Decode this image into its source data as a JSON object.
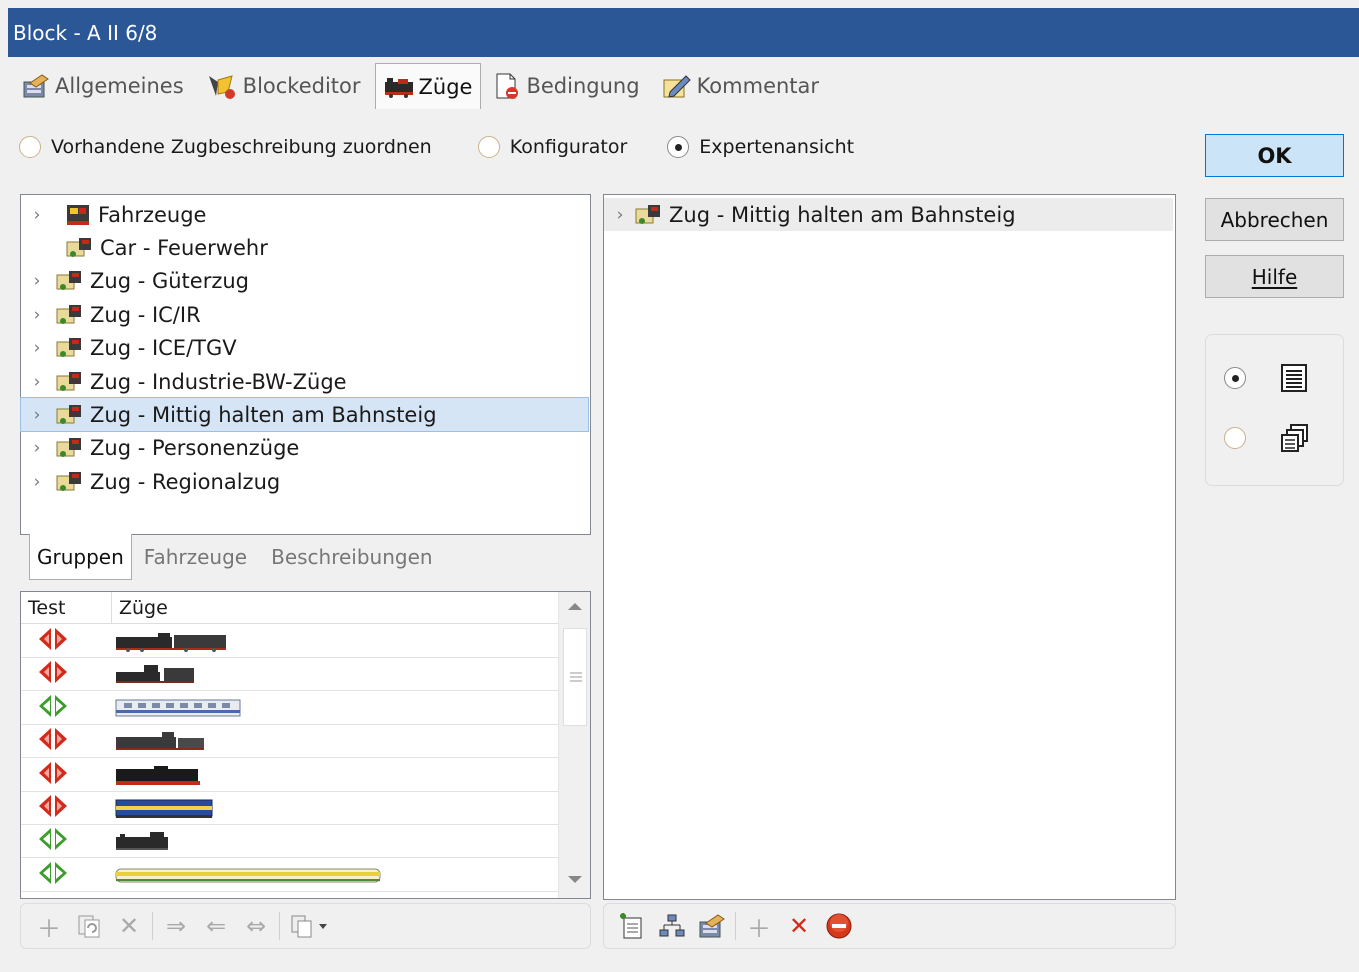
{
  "window": {
    "title": "Block - A II 6/8"
  },
  "tabs": [
    {
      "label": "Allgemeines",
      "icon": "properties-icon"
    },
    {
      "label": "Blockeditor",
      "icon": "block-editor-icon"
    },
    {
      "label": "Züge",
      "icon": "trains-icon",
      "active": true
    },
    {
      "label": "Bedingung",
      "icon": "condition-icon"
    },
    {
      "label": "Kommentar",
      "icon": "comment-icon"
    }
  ],
  "mode": {
    "options": [
      "Vorhandene Zugbeschreibung zuordnen",
      "Konfigurator",
      "Expertenansicht"
    ],
    "selected": "Expertenansicht"
  },
  "buttons": {
    "ok": "OK",
    "cancel": "Abbrechen",
    "help": "Hilfe"
  },
  "view": {
    "selected": "list-view"
  },
  "tree": {
    "items": [
      "Fahrzeuge",
      "Car - Feuerwehr",
      "Zug - Güterzug",
      "Zug - IC/IR",
      "Zug - ICE/TGV",
      "Zug - Industrie-BW-Züge",
      "Zug - Mittig halten am Bahnsteig",
      "Zug - Personenzüge",
      "Zug - Regionalzug"
    ],
    "selected": "Zug - Mittig halten am Bahnsteig"
  },
  "subtabs": [
    "Gruppen",
    "Fahrzeuge",
    "Beschreibungen"
  ],
  "grid": {
    "columns": [
      "Test",
      "Züge"
    ],
    "rows": [
      {
        "status": "red",
        "train": "steam-locomotive-with-tender"
      },
      {
        "status": "red",
        "train": "small-steam-locomotive"
      },
      {
        "status": "green",
        "train": "blue-white-passenger-railcar"
      },
      {
        "status": "red",
        "train": "steam-locomotive"
      },
      {
        "status": "red",
        "train": "black-red-steam-locomotive"
      },
      {
        "status": "red",
        "train": "blue-yellow-diesel-locomotive"
      },
      {
        "status": "green",
        "train": "small-tank-locomotive"
      },
      {
        "status": "green",
        "train": "yellow-white-multiple-unit"
      }
    ]
  },
  "right": {
    "item": "Zug - Mittig halten am Bahnsteig"
  },
  "colors": {
    "titlebar": "#2b5797",
    "selection": "#d6e5f5",
    "status_red": "#d42a1a",
    "status_green": "#3c9c2c",
    "accent": "#0078d7"
  }
}
